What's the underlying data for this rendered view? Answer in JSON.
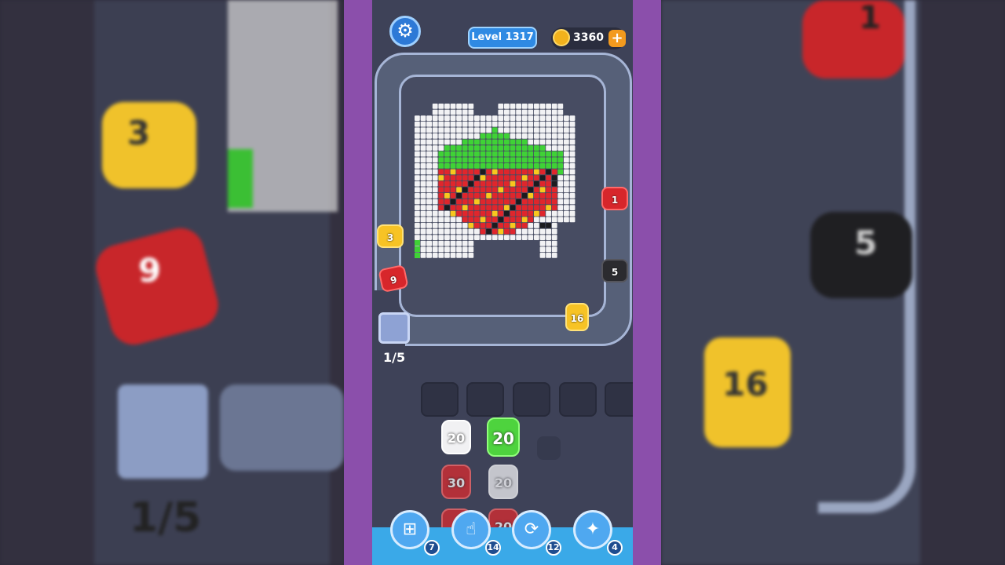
{
  "header": {
    "settings_icon": "gear-icon",
    "level_label": "Level 1317",
    "coins": "3360",
    "coin_add_icon": "plus-icon"
  },
  "track": {
    "counter": "1/5"
  },
  "shooters": [
    {
      "value": "1",
      "color": "red"
    },
    {
      "value": "3",
      "color": "yellow"
    },
    {
      "value": "9",
      "color": "red"
    },
    {
      "value": "5",
      "color": "black"
    },
    {
      "value": "16",
      "color": "yellow"
    }
  ],
  "queue": {
    "slots": 5,
    "columns": [
      {
        "blocks": [
          {
            "value": "20",
            "color": "white"
          },
          {
            "value": "30",
            "color": "red"
          },
          {
            "value": "",
            "color": "red"
          }
        ]
      },
      {
        "blocks": [
          {
            "value": "20",
            "color": "green"
          },
          {
            "value": "20",
            "color": "white"
          },
          {
            "value": "20",
            "color": "red"
          }
        ]
      }
    ]
  },
  "boosters": [
    {
      "icon": "add-slot-icon",
      "count": "7"
    },
    {
      "icon": "hand-icon",
      "count": "14"
    },
    {
      "icon": "shuffle-icon",
      "count": "12"
    },
    {
      "icon": "magic-icon",
      "count": "4"
    }
  ],
  "colors": {
    "white": "#f2f2f4",
    "green": "#3fd236",
    "red": "#e0262c",
    "yellow": "#f8c81e",
    "black": "#1b1b1f"
  },
  "background": {
    "left_numbers": [
      "3",
      "9",
      "1/5"
    ],
    "right_numbers": [
      "1",
      "5",
      "16"
    ]
  }
}
